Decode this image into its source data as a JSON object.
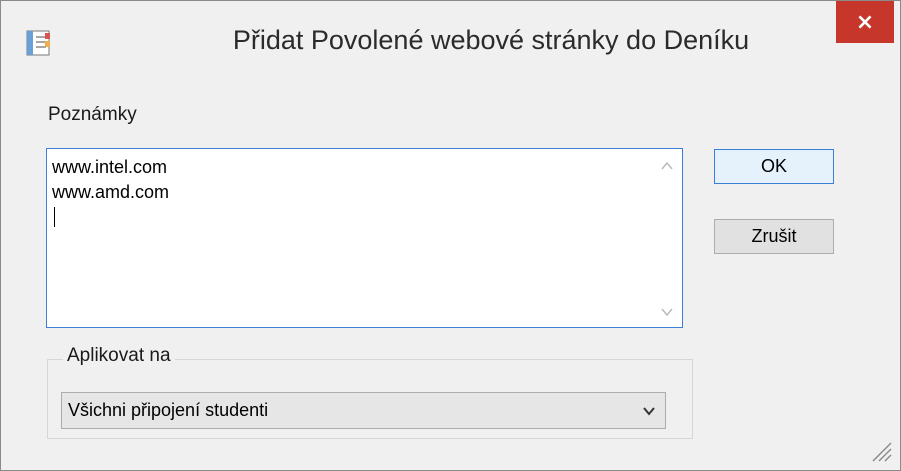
{
  "window": {
    "title": "Přidat Povolené webové stránky do Deníku",
    "close_icon": "×"
  },
  "notes": {
    "label": "Poznámky",
    "content": "www.intel.com\nwww.amd.com",
    "scroll_up": "^",
    "scroll_down": "v"
  },
  "buttons": {
    "ok_label": "OK",
    "cancel_label": "Zrušit"
  },
  "apply_to": {
    "legend": "Aplikovat na",
    "selected": "Všichni připojení studenti",
    "arrow": "⌄"
  },
  "icons": {
    "app": "journal-icon",
    "close": "close-icon",
    "resize": "resize-grip-icon"
  },
  "colors": {
    "close_button": "#c7362b",
    "focus_border": "#3c7fd6"
  }
}
